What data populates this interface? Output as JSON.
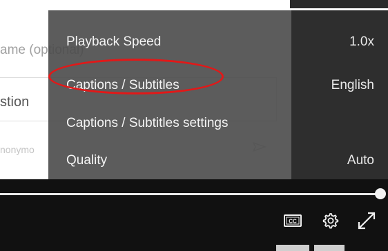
{
  "background_form": {
    "name_label": "ame (optional)",
    "question_label": "stion",
    "anonymous_label": "nonymo"
  },
  "settings_menu": {
    "items": [
      {
        "label": "Playback Speed",
        "value": "1.0x"
      },
      {
        "label": "Captions / Subtitles",
        "value": "English"
      },
      {
        "label": "Captions / Subtitles settings",
        "value": ""
      },
      {
        "label": "Quality",
        "value": "Auto"
      }
    ]
  },
  "player": {
    "progress": 1.0
  },
  "icons": {
    "cc": "closed-captions-icon",
    "settings": "gear-icon",
    "fullscreen": "expand-icon",
    "send": "send-icon"
  },
  "colors": {
    "highlight": "#e21818",
    "menu_bg": "#4a4a4a",
    "player_bg": "#111111"
  }
}
